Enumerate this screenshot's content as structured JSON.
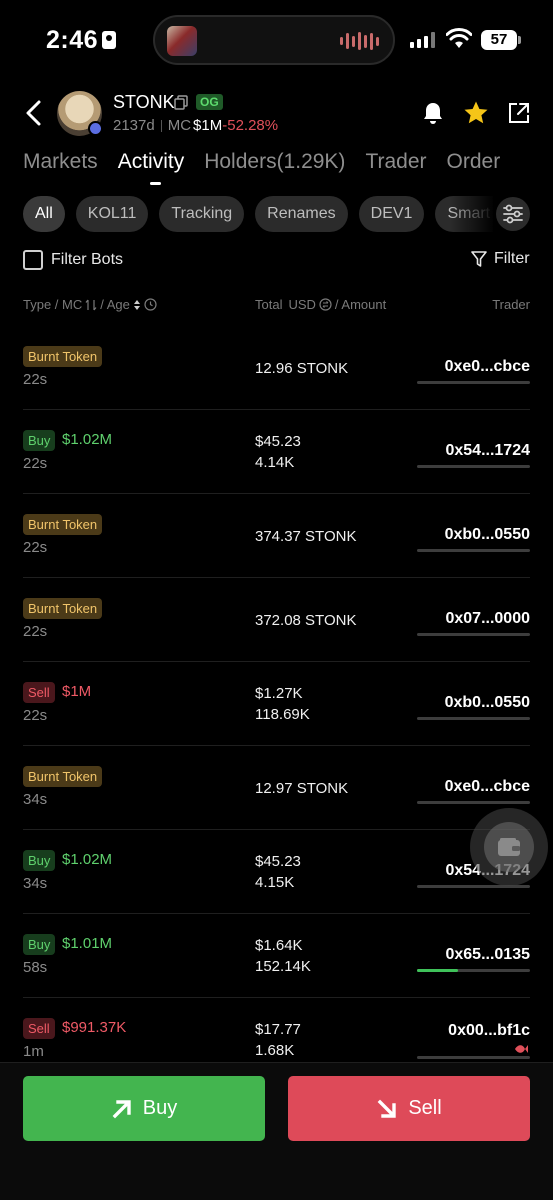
{
  "status_bar": {
    "time": "2:46",
    "battery": "57"
  },
  "token": {
    "name": "STONK",
    "badge": "OG",
    "age": "2137d",
    "mc_label": "MC",
    "mc_value": "$1M",
    "mc_change": "-52.28%"
  },
  "tabs": [
    "Markets",
    "Activity",
    "Holders(1.29K)",
    "Trader",
    "Order"
  ],
  "active_tab": "Activity",
  "filters": {
    "chips": [
      "All",
      "KOL11",
      "Tracking",
      "Renames",
      "DEV1",
      "Smart M"
    ],
    "filter_bots_label": "Filter Bots",
    "filter_label": "Filter"
  },
  "columns": {
    "type_mc": "Type / MC",
    "age": "/ Age",
    "total": "Total",
    "usd": "USD",
    "amount": "/ Amount",
    "trader": "Trader"
  },
  "rows": [
    {
      "type": "Burnt Token",
      "kind": "burn",
      "mc": "",
      "age": "22s",
      "line1": "12.96 STONK",
      "line2": "",
      "trader": "0xe0...cbce",
      "bar": 0
    },
    {
      "type": "Buy",
      "kind": "buy",
      "mc": "$1.02M",
      "age": "22s",
      "line1": "$45.23",
      "line2": "4.14K",
      "trader": "0x54...1724",
      "bar": 0
    },
    {
      "type": "Burnt Token",
      "kind": "burn",
      "mc": "",
      "age": "22s",
      "line1": "374.37 STONK",
      "line2": "",
      "trader": "0xb0...0550",
      "bar": 0
    },
    {
      "type": "Burnt Token",
      "kind": "burn",
      "mc": "",
      "age": "22s",
      "line1": "372.08 STONK",
      "line2": "",
      "trader": "0x07...0000",
      "bar": 0
    },
    {
      "type": "Sell",
      "kind": "sell",
      "mc": "$1M",
      "age": "22s",
      "line1": "$1.27K",
      "line2": "118.69K",
      "trader": "0xb0...0550",
      "bar": 0
    },
    {
      "type": "Burnt Token",
      "kind": "burn",
      "mc": "",
      "age": "34s",
      "line1": "12.97 STONK",
      "line2": "",
      "trader": "0xe0...cbce",
      "bar": 0
    },
    {
      "type": "Buy",
      "kind": "buy",
      "mc": "$1.02M",
      "age": "34s",
      "line1": "$45.23",
      "line2": "4.15K",
      "trader": "0x54...1724",
      "bar": 0
    },
    {
      "type": "Buy",
      "kind": "buy",
      "mc": "$1.01M",
      "age": "58s",
      "line1": "$1.64K",
      "line2": "152.14K",
      "trader": "0x65...0135",
      "bar": 0.36
    },
    {
      "type": "Sell",
      "kind": "sell",
      "mc": "$991.37K",
      "age": "1m",
      "line1": "$17.77",
      "line2": "1.68K",
      "trader": "0x00...bf1c",
      "bar": 0,
      "icon": "fish-icon"
    }
  ],
  "actions": {
    "buy_label": "Buy",
    "sell_label": "Sell"
  },
  "colors": {
    "buy": "#43b54f",
    "sell": "#de4a59",
    "burn": "#f0c46a",
    "accent_star": "#f5c518"
  }
}
